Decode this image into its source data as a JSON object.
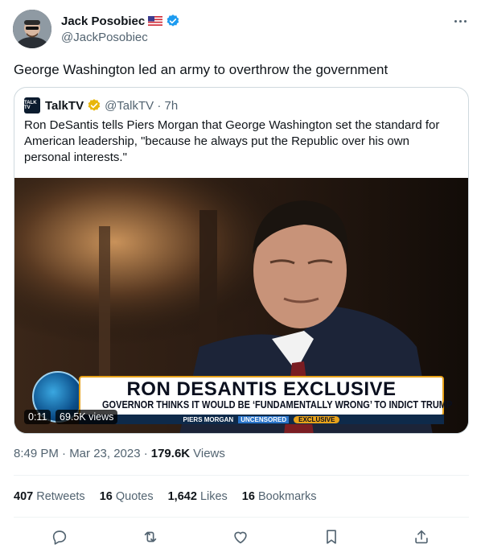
{
  "author": {
    "display_name": "Jack Posobiec",
    "handle": "@JackPosobiec",
    "flag": "us-flag-icon",
    "verified_color": "#1d9bf0"
  },
  "tweet": {
    "text": "George Washington led an army to overthrow the government"
  },
  "quote": {
    "display_name": "TalkTV",
    "handle_time": "@TalkTV · 7h",
    "avatar_text": "TALK TV",
    "verified_color": "#e8b60c",
    "text": "Ron DeSantis tells Piers Morgan that George Washington set the standard for American leadership, \"because he always put the Republic over his own personal interests.\"",
    "video": {
      "chyron_title": "RON DESANTIS EXCLUSIVE",
      "chyron_sub": "GOVERNOR THINKS IT WOULD BE ‘FUNDAMENTALLY WRONG’ TO INDICT TRUMP",
      "bar_show": "PIERS MORGAN",
      "bar_uncensored": "UNCENSORED",
      "bar_exclusive": "EXCLUSIVE",
      "duration": "0:11",
      "views": "69.5K views"
    }
  },
  "meta": {
    "time": "8:49 PM · Mar 23, 2023 ·",
    "views_count": "179.6K",
    "views_label": "Views"
  },
  "stats": {
    "retweets_count": "407",
    "retweets_label": "Retweets",
    "quotes_count": "16",
    "quotes_label": "Quotes",
    "likes_count": "1,642",
    "likes_label": "Likes",
    "bookmarks_count": "16",
    "bookmarks_label": "Bookmarks"
  },
  "actions": [
    "reply-icon",
    "retweet-icon",
    "like-icon",
    "bookmark-icon",
    "share-icon"
  ]
}
